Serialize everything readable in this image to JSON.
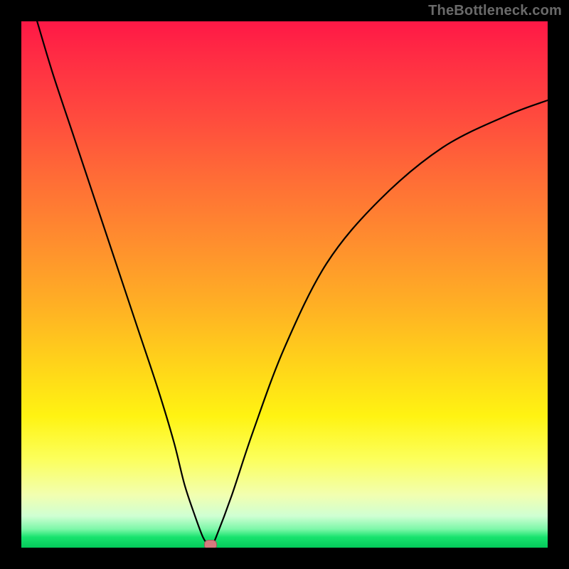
{
  "watermark": "TheBottleneck.com",
  "chart_data": {
    "type": "line",
    "title": "",
    "xlabel": "",
    "ylabel": "",
    "xlim": [
      0,
      100
    ],
    "ylim": [
      0,
      100
    ],
    "grid": false,
    "legend": false,
    "series": [
      {
        "name": "bottleneck-curve",
        "x": [
          3,
          6,
          10,
          14,
          18,
          22,
          26,
          29,
          31,
          33,
          34.5,
          35.5,
          36,
          37,
          40,
          44,
          50,
          58,
          68,
          80,
          92,
          100
        ],
        "values": [
          100,
          90,
          78,
          66,
          54,
          42,
          30,
          20,
          12,
          6,
          2,
          0.5,
          0,
          2,
          10,
          22,
          38,
          54,
          66,
          76,
          82,
          85
        ]
      }
    ],
    "annotations": [
      {
        "name": "min-marker",
        "x": 36,
        "y": 0.5,
        "shape": "pill",
        "color": "#d67a7e"
      }
    ],
    "background": {
      "type": "vertical-gradient",
      "stops": [
        {
          "pos": 0,
          "color": "#ff1846"
        },
        {
          "pos": 50,
          "color": "#ffb024"
        },
        {
          "pos": 78,
          "color": "#fff312"
        },
        {
          "pos": 100,
          "color": "#04c95a"
        }
      ]
    }
  }
}
